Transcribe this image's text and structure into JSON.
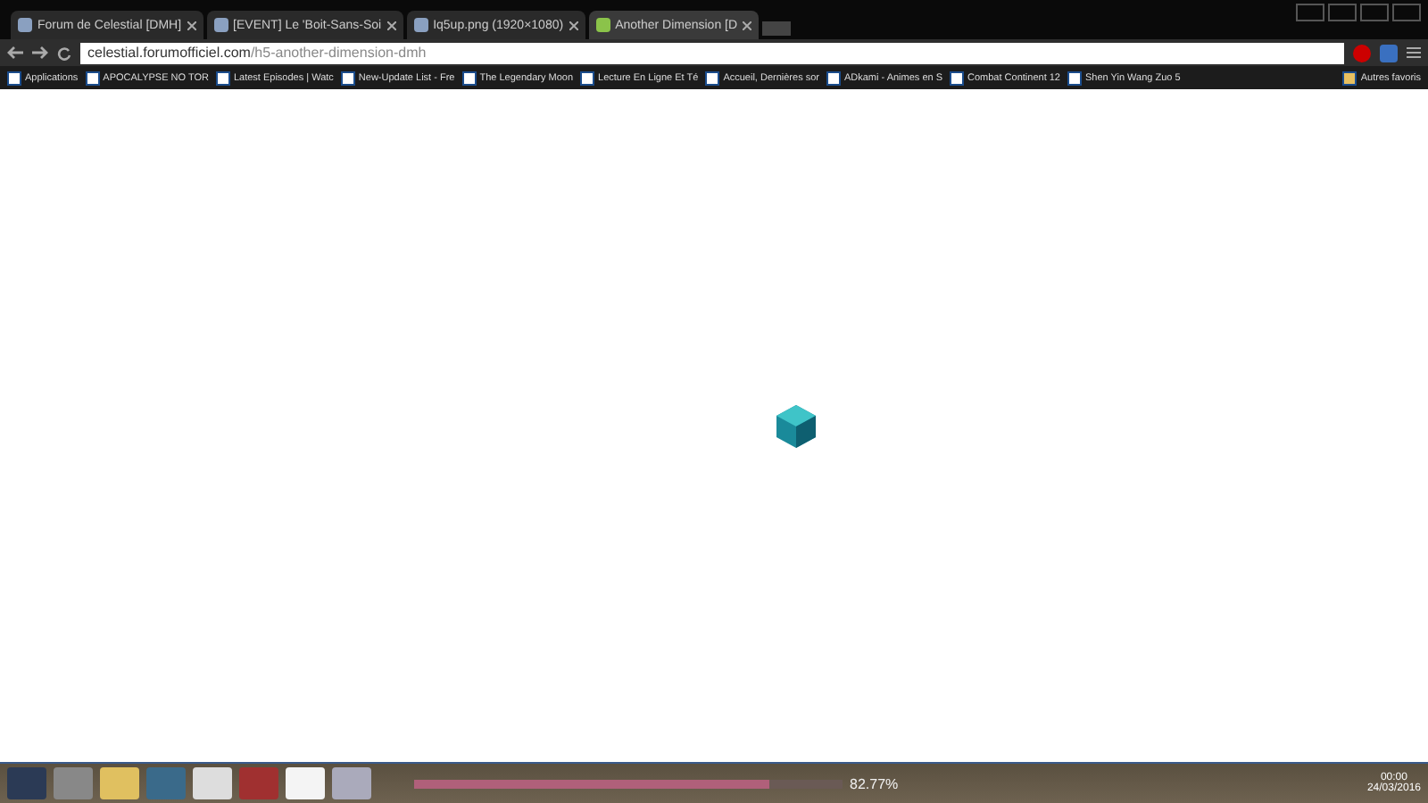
{
  "tabs": [
    {
      "title": "Forum de Celestial [DMH]",
      "selected": false
    },
    {
      "title": "[EVENT] Le 'Boit-Sans-Soi",
      "selected": false
    },
    {
      "title": "Iq5up.png (1920×1080)",
      "selected": false
    },
    {
      "title": "Another Dimension [D",
      "selected": true
    }
  ],
  "address": {
    "host": "celestial.forumofficiel.com",
    "path": "/h5-another-dimension-dmh"
  },
  "bookmarks": [
    "Applications",
    "APOCALYPSE NO TOR",
    "Latest Episodes | Watc",
    "New-Update List - Fre",
    "The Legendary Moon",
    "Lecture En Ligne Et Té",
    "Accueil, Dernières sor",
    "ADkami - Animes en S",
    "Combat Continent 12",
    "Shen Yin Wang Zuo 5"
  ],
  "other_bookmarks": "Autres favoris",
  "taskbar": {
    "progress": {
      "level": 0.8277,
      "reading": "82.77%"
    },
    "time": "00:00",
    "date": "24/03/2016"
  }
}
